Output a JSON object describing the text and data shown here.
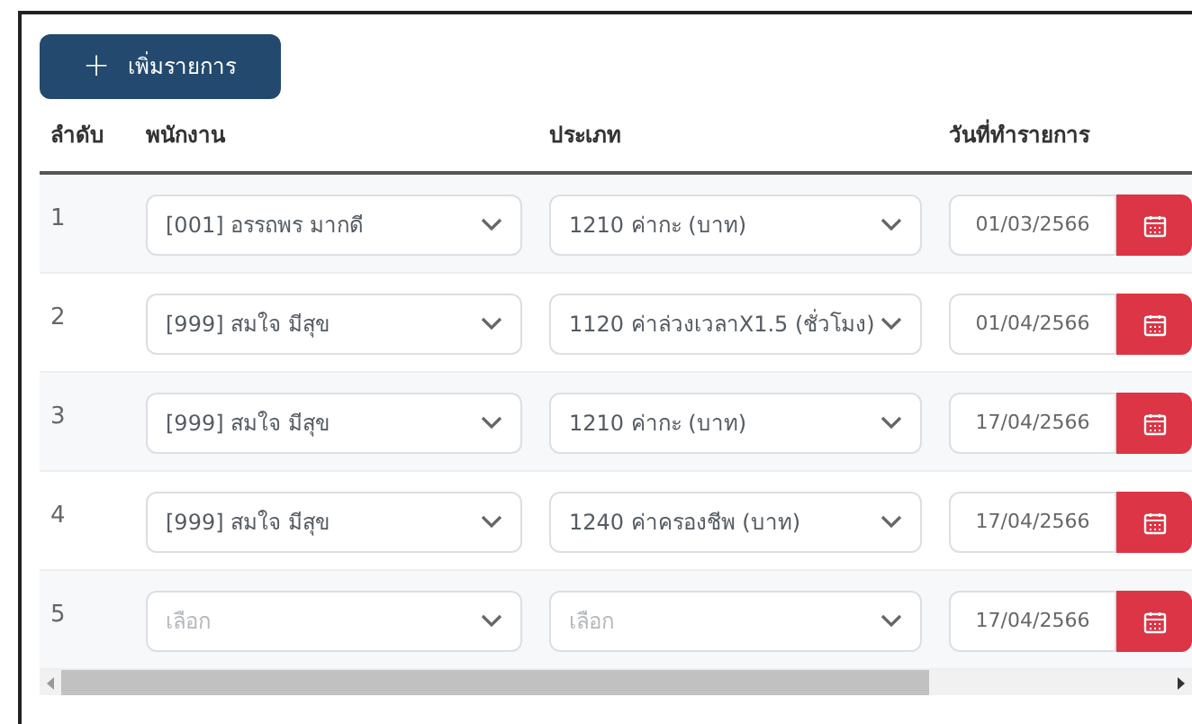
{
  "add_button": {
    "icon": "+",
    "label": "เพิ่มรายการ"
  },
  "columns": [
    "ลำดับ",
    "พนักงาน",
    "ประเภท",
    "วันที่ทำรายการ"
  ],
  "rows": [
    {
      "number": "1",
      "employee": {
        "value": "[001] อรรถพร มากดี"
      },
      "type": {
        "value": "1210 ค่ากะ (บาท)"
      },
      "date": "01/03/2566"
    },
    {
      "number": "2",
      "employee": {
        "value": "[999] สมใจ มีสุข"
      },
      "type": {
        "value": "1120 ค่าล่วงเวลาX1.5 (ชั่วโมง)"
      },
      "date": "01/04/2566"
    },
    {
      "number": "3",
      "employee": {
        "value": "[999] สมใจ มีสุข"
      },
      "type": {
        "value": "1210 ค่ากะ (บาท)"
      },
      "date": "17/04/2566"
    },
    {
      "number": "4",
      "employee": {
        "value": "[999] สมใจ มีสุข"
      },
      "type": {
        "value": "1240 ค่าครองชีพ (บาท)"
      },
      "date": "17/04/2566"
    },
    {
      "number": "5",
      "employee": {
        "placeholder": "เลือก"
      },
      "type": {
        "placeholder": "เลือก"
      },
      "date": "17/04/2566"
    }
  ]
}
